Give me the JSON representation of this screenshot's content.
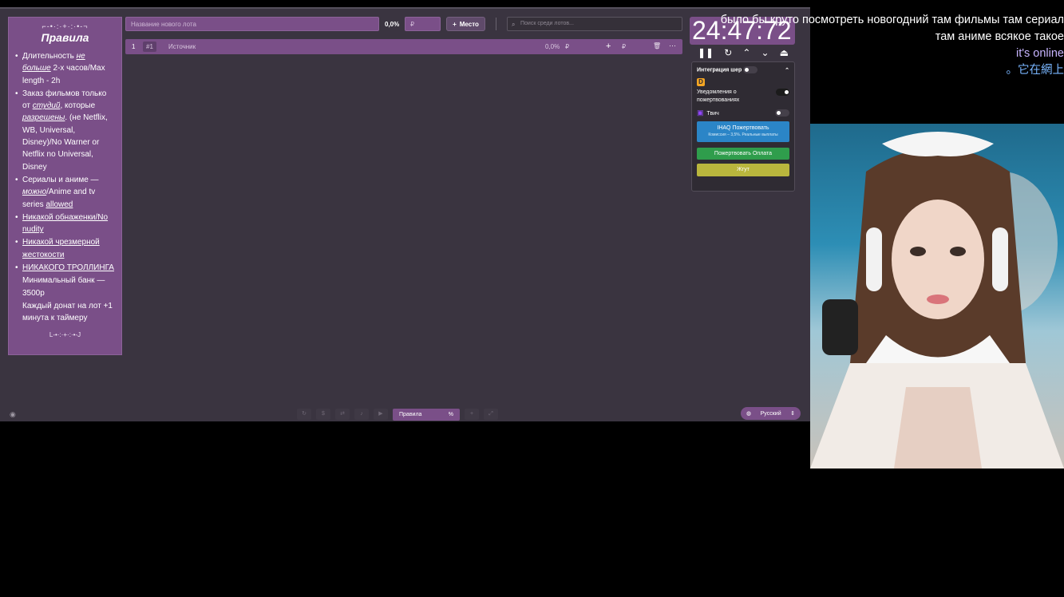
{
  "rules": {
    "ornament_top": "⌐-•·:·+·:·•-¬",
    "title": "Правила",
    "items": [
      {
        "parts": [
          "Длительность ",
          "не больше",
          " 2-х часов/Max length - 2h"
        ]
      },
      {
        "parts": [
          "Заказ фильмов только от ",
          "студий",
          ", которые ",
          "разрешены",
          ". (не Netflix, WB, Universal, Disney)/No Warner or Netflix no Universal, Disney"
        ]
      },
      {
        "parts": [
          "Сериалы и аниме — ",
          "можно",
          "/Anime and tv series ",
          "allowed"
        ]
      },
      {
        "text": "Никакой обнаженки/No nudity"
      },
      {
        "text": "Никакой чрезмерной жестокости"
      },
      {
        "text": "НИКАКОГО ТРОЛЛИНГА"
      }
    ],
    "min_bank": "Минимальный банк — 3500р",
    "donate_rule": "Каждый донат на лот +1 минута к таймеру",
    "ornament_bottom": "L-•·:·+·:·•-J"
  },
  "toolbar": {
    "lot_name_placeholder": "Название нового лота",
    "percent": "0,0%",
    "money_placeholder": "₽",
    "add_place_label": "Место",
    "search_placeholder": "Поиск среди лотов..."
  },
  "lot": {
    "index": "1",
    "tag": "#1",
    "source": "Источник",
    "percent": "0,0%",
    "currency": "₽",
    "currency2": "₽"
  },
  "timer": {
    "value": "24:47:72"
  },
  "integration": {
    "title": "Интеграция шер",
    "notifications_label": "Уведомления о пожертвованиях",
    "twitch_label": "Твич",
    "ihaq_label": "IHAQ Пожертвовать",
    "ihaq_sub": "Комиссия – 3,5%. Реальные выплаты",
    "pay_label": "Пожертвовать Оплата",
    "jgut_label": "Жгут"
  },
  "bottom": {
    "rules_tab_label": "Правила",
    "rules_tab_icon": "%",
    "language": "Русский"
  },
  "chat": {
    "line1": "было бы круто посмотреть новогодний там фильмы там сериал",
    "line2": "там аниме всякое такое",
    "line3": "it's online",
    "line4": "。它在網上"
  }
}
